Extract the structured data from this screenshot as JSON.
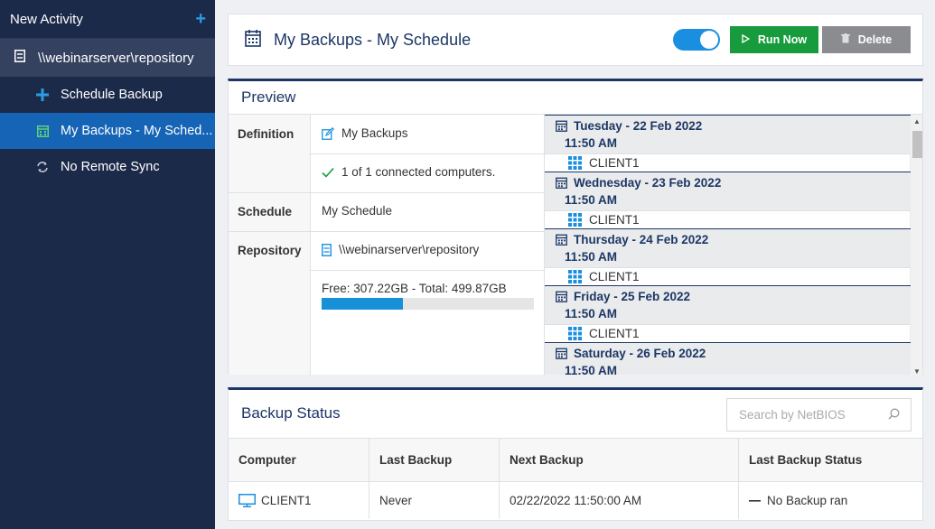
{
  "sidebar": {
    "header": "New Activity",
    "repository": "\\\\webinarserver\\repository",
    "items": [
      {
        "label": "Schedule Backup",
        "icon": "plus-icon"
      },
      {
        "label": "My Backups - My Sched...",
        "icon": "calendar-icon",
        "active": true
      },
      {
        "label": "No Remote Sync",
        "icon": "sync-icon"
      }
    ]
  },
  "header": {
    "title": "My Backups - My Schedule",
    "toggle_on": true,
    "run_label": "Run Now",
    "delete_label": "Delete"
  },
  "preview": {
    "title": "Preview",
    "labels": {
      "definition": "Definition",
      "schedule": "Schedule",
      "repository": "Repository"
    },
    "definition_name": "My Backups",
    "connected": "1 of 1 connected computers.",
    "schedule_name": "My Schedule",
    "repository_path": "\\\\webinarserver\\repository",
    "storage_text": "Free: 307.22GB - Total: 499.87GB",
    "storage_used_fraction": 0.385,
    "schedule_entries": [
      {
        "date": "Tuesday - 22 Feb 2022",
        "time": "11:50 AM",
        "client": "CLIENT1"
      },
      {
        "date": "Wednesday - 23 Feb 2022",
        "time": "11:50 AM",
        "client": "CLIENT1"
      },
      {
        "date": "Thursday - 24 Feb 2022",
        "time": "11:50 AM",
        "client": "CLIENT1"
      },
      {
        "date": "Friday - 25 Feb 2022",
        "time": "11:50 AM",
        "client": "CLIENT1"
      },
      {
        "date": "Saturday - 26 Feb 2022",
        "time": "11:50 AM",
        "client": ""
      }
    ]
  },
  "status": {
    "title": "Backup Status",
    "search_placeholder": "Search by NetBIOS",
    "columns": [
      "Computer",
      "Last Backup",
      "Next Backup",
      "Last Backup Status"
    ],
    "rows": [
      {
        "computer": "CLIENT1",
        "last_backup": "Never",
        "next_backup": "02/22/2022 11:50:00 AM",
        "last_status": "No Backup ran"
      }
    ]
  },
  "colors": {
    "accent": "#1664b6",
    "run": "#179b3c",
    "delete": "#8a8c8f",
    "sidebar": "#1c2a4a",
    "title": "#1c3766"
  }
}
